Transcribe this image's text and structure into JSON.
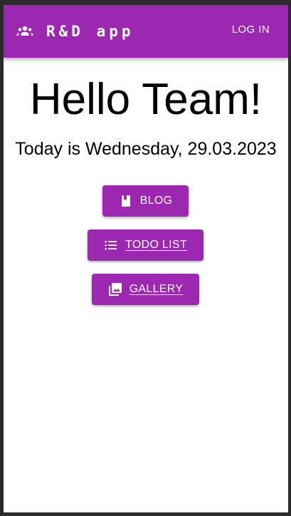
{
  "colors": {
    "primary": "#9c27b0",
    "appbar_text": "#ffffff",
    "background": "#ffffff"
  },
  "header": {
    "brand_icon": "groups-icon",
    "title": "R&D app",
    "login_label": "LOG IN"
  },
  "main": {
    "greeting": "Hello Team!",
    "date_text": "Today is Wednesday, 29.03.2023",
    "buttons": [
      {
        "label": "BLOG",
        "icon": "book-icon"
      },
      {
        "label": "TODO LIST",
        "icon": "list-icon"
      },
      {
        "label": "GALLERY",
        "icon": "photo-library-icon"
      }
    ]
  }
}
